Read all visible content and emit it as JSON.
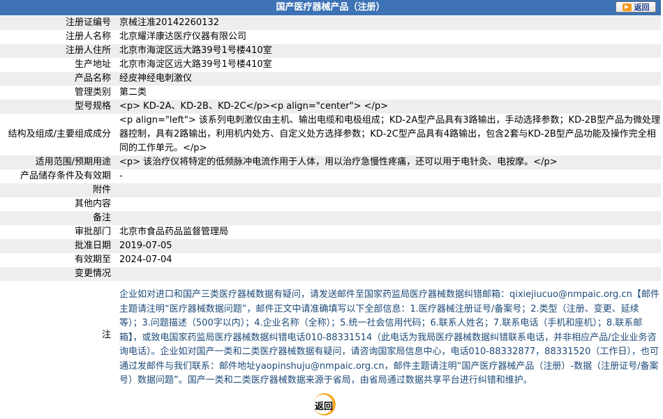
{
  "header": {
    "title": "国产医疗器械产品（注册）",
    "back_label": "返回"
  },
  "rows": [
    {
      "label": "注册证编号",
      "value": "京械注准20142260132"
    },
    {
      "label": "注册人名称",
      "value": "北京耀洋康达医疗仪器有限公司"
    },
    {
      "label": "注册人住所",
      "value": "北京市海淀区远大路39号1号楼410室"
    },
    {
      "label": "生产地址",
      "value": "北京市海淀区远大路39号1号楼410室"
    },
    {
      "label": "产品名称",
      "value": "经皮神经电刺激仪"
    },
    {
      "label": "管理类别",
      "value": "第二类"
    },
    {
      "label": "型号规格",
      "value": "<p> KD-2A、KD-2B、KD-2C</p><p align=\"center\"> </p>"
    },
    {
      "label": "结构及组成/主要组成成分",
      "value": "<p align=\"left\"> 该系列电刺激仪由主机、输出电缆和电极组成；KD-2A型产品具有3路输出，手动选择参数；KD-2B型产品为微处理器控制，具有2路输出，利用机内处方、自定义处方选择参数；KD-2C型产品具有4路输出，包含2套与KD-2B型产品功能及操作完全相同的工作单元。</p>"
    },
    {
      "label": "适用范围/预期用途",
      "value": "<p> 该治疗仪将特定的低频脉冲电流作用于人体，用以治疗急慢性疼痛，还可以用于电针灸、电按摩。</p>"
    },
    {
      "label": "产品储存条件及有效期",
      "value": "-"
    },
    {
      "label": "附件",
      "value": ""
    },
    {
      "label": "其他内容",
      "value": ""
    },
    {
      "label": "备注",
      "value": ""
    },
    {
      "label": "审批部门",
      "value": "北京市食品药品监督管理局"
    },
    {
      "label": "批准日期",
      "value": "2019-07-05"
    },
    {
      "label": "有效期至",
      "value": "2024-07-04"
    },
    {
      "label": "变更情况",
      "value": ""
    }
  ],
  "note": {
    "label": "注",
    "text": "企业如对进口和国产三类医疗器械数据有疑问，请发送邮件至国家药监局医疗器械数据纠错邮箱：qixiejiucuo@nmpaic.org.cn【邮件主题请注明“医疗器械数据问题”，邮件正文中请准确填写以下全部信息：1.医疗器械注册证号/备案号；2.类型（注册、变更、延续等）；3.问题描述（500字以内）；4.企业名称（全称）；5.统一社会信用代码；6.联系人姓名；7.联系电话（手机和座机）；8.联系邮箱】，或致电国家药监局医疗器械数据纠错电话010-88331514（此电话为我局医疗器械数据纠错联系电话，并非相应产品/企业业务咨询电话）。企业如对国产一类和二类医疗器械数据有疑问，请咨询国家局信息中心，电话010-88332877，88331520（工作日），也可通过发邮件与我们联系：邮件地址yaopinshuju@nmpaic.org.cn，邮件主题请注明“国产医疗器械产品（注册）-数据（注册证号/备案号）数据问题”。国产一类和二类医疗器械数据来源于省局，由省局通过数据共享平台进行纠错和维护。"
  },
  "footer": {
    "back_label": "返回"
  }
}
